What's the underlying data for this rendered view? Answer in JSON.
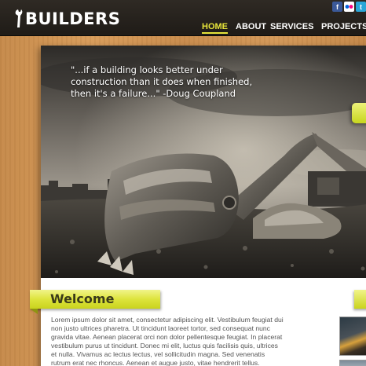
{
  "header": {
    "logo_text": "BUILDERS",
    "nav": [
      {
        "label": "HOME",
        "active": true
      },
      {
        "label": "ABOUT",
        "active": false
      },
      {
        "label": "SERVICES",
        "active": false
      },
      {
        "label": "PROJECTS",
        "active": false
      }
    ],
    "social": [
      {
        "icon": "facebook-icon",
        "glyph": "f",
        "color": "#3b5998"
      },
      {
        "icon": "flickr-icon",
        "glyph": "••",
        "color": "#ffffff"
      },
      {
        "icon": "twitter-icon",
        "glyph": "t",
        "color": "#2ba6d8"
      }
    ]
  },
  "hero": {
    "quote": "\"...if a building looks better under construction than it does when finished, then it's a failure...\" -Doug Coupland"
  },
  "welcome": {
    "title": "Welcome",
    "body": "Lorem ipsum dolor sit amet, consectetur adipiscing elit. Vestibulum feugiat dui non justo ultrices pharetra. Ut tincidunt laoreet tortor, sed consequat nunc gravida vitae. Aenean placerat orci non dolor pellentesque feugiat. In placerat vestibulum purus ut tincidunt. Donec mi elit, luctus quis facilisis quis, ultrices et nulla. Vivamus ac lectus lectus, vel sollicitudin magna. Sed venenatis rutrum erat nec rhoncus. Aenean et augue justo, vitae hendrerit tellus."
  },
  "colors": {
    "accent": "#e6e43a",
    "header_bg": "#25211c",
    "wood": "#d0924f"
  }
}
